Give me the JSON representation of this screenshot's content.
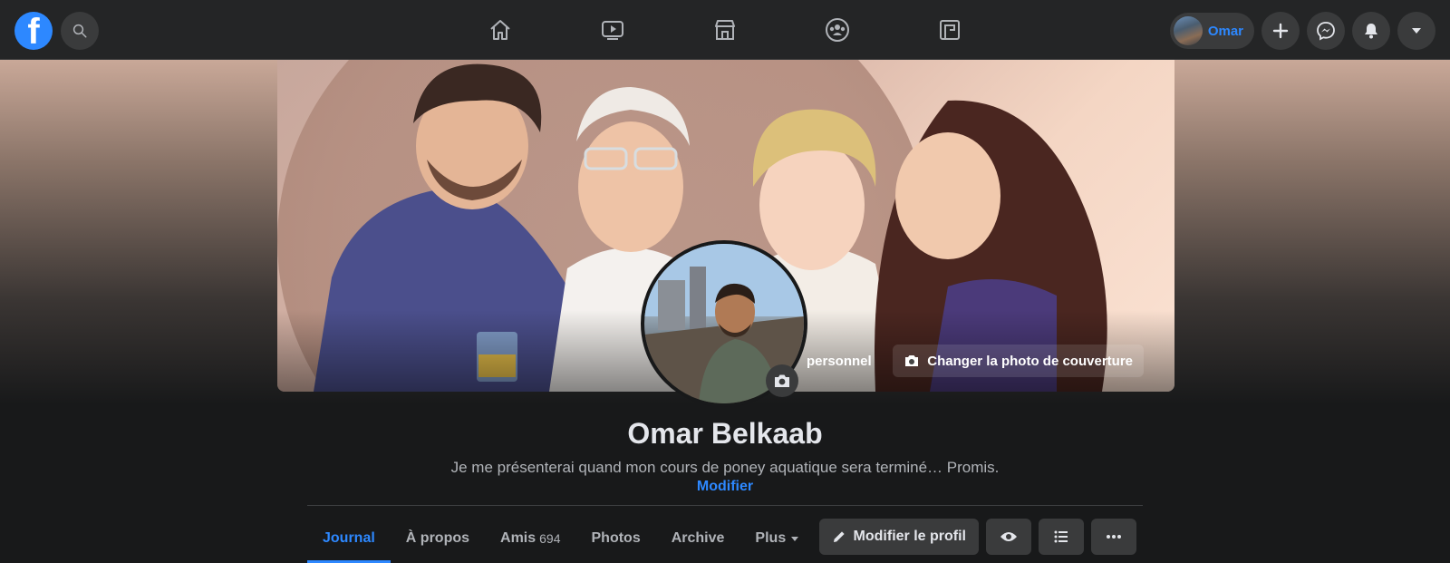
{
  "topbar": {
    "logo_letter": "f",
    "icons": [
      "facebook-logo",
      "search-icon",
      "home-icon",
      "watch-icon",
      "marketplace-icon",
      "groups-icon",
      "gaming-icon",
      "plus-icon",
      "messenger-icon",
      "bell-icon",
      "caret-down-icon"
    ],
    "profile_name": "Omar"
  },
  "cover": {
    "edit_profile_photo_label": "personnel",
    "change_cover_label": "Changer la photo de couverture"
  },
  "profile": {
    "name": "Omar Belkaab",
    "bio": "Je me présenterai quand mon cours de poney aquatique sera terminé… Promis.",
    "bio_edit": "Modifier"
  },
  "tabs": [
    {
      "label": "Journal",
      "active": true
    },
    {
      "label": "À propos"
    },
    {
      "label": "Amis",
      "count": "694"
    },
    {
      "label": "Photos"
    },
    {
      "label": "Archive"
    },
    {
      "label": "Plus"
    }
  ],
  "actions": {
    "edit_profile": "Modifier le profil"
  },
  "colors": {
    "accent": "#2d88ff",
    "background": "#18191a",
    "surface": "#242526",
    "button": "#3a3b3c"
  }
}
